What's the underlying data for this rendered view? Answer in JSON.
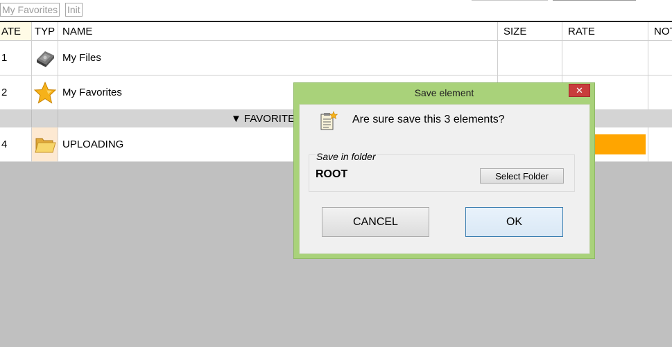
{
  "tabs": [
    "My Favorites",
    "Init"
  ],
  "table": {
    "columns": [
      "ATE",
      "TYP",
      "NAME",
      "SIZE",
      "RATE",
      "NOT"
    ],
    "rows": [
      {
        "id": "1",
        "icon": "hard-drive-icon",
        "name": "My Files",
        "size": "",
        "rate": ""
      },
      {
        "id": "2",
        "icon": "star-icon",
        "name": "My Favorites",
        "size": "",
        "rate": ""
      },
      {
        "id": "4",
        "icon": "folder-icon",
        "name": "UPLOADING",
        "size": "",
        "rate": ""
      }
    ],
    "group_label": "▼ FAVORITE"
  },
  "dialog": {
    "title": "Save element",
    "close_icon": "✕",
    "message": "Are sure save this 3 elements?",
    "folder_legend": "Save in folder",
    "folder_value": "ROOT",
    "select_folder_label": "Select Folder",
    "cancel_label": "CANCEL",
    "ok_label": "OK"
  },
  "colors": {
    "dialog_frame": "#a9d27a",
    "rate_bar": "#ffa500",
    "close_button": "#c83c3c",
    "group_row": "#d4d4d4"
  }
}
